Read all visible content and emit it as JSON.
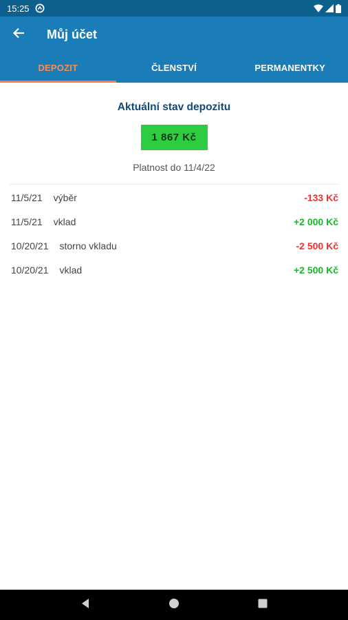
{
  "status_bar": {
    "time": "15:25"
  },
  "app_bar": {
    "title": "Můj účet"
  },
  "tabs": [
    {
      "label": "DEPOZIT",
      "active": true
    },
    {
      "label": "ČLENSTVÍ",
      "active": false
    },
    {
      "label": "PERMANENTKY",
      "active": false
    }
  ],
  "deposit": {
    "heading": "Aktuální stav depozitu",
    "balance": "1 867 Kč",
    "validity": "Platnost do 11/4/22"
  },
  "transactions": [
    {
      "date": "11/5/21",
      "description": "výběr",
      "amount": "-133 Kč"
    },
    {
      "date": "11/5/21",
      "description": "vklad",
      "amount": "+2 000 Kč"
    },
    {
      "date": "10/20/21",
      "description": "storno vkladu",
      "amount": "-2 500 Kč"
    },
    {
      "date": "10/20/21",
      "description": "vklad",
      "amount": "+2 500 Kč"
    }
  ],
  "colors": {
    "status_bar": "#0d5f8e",
    "app_bar": "#1a7db8",
    "active_tab": "#ff8a50",
    "balance_bg": "#2ecc40",
    "negative": "#ff2a2a",
    "positive": "#19b82a"
  }
}
